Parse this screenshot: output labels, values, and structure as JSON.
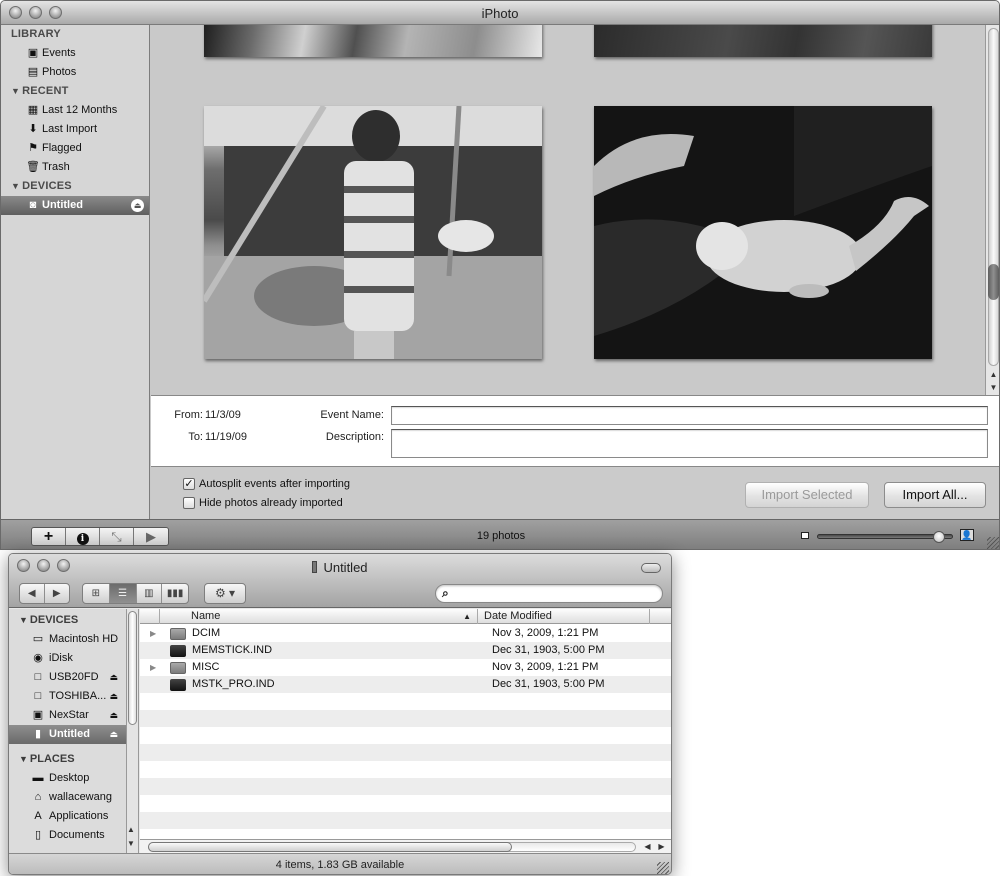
{
  "iphoto": {
    "title": "iPhoto",
    "sidebar": {
      "sections": [
        {
          "label": "LIBRARY",
          "collapsible": false,
          "items": [
            {
              "label": "Events",
              "icon": "events-icon"
            },
            {
              "label": "Photos",
              "icon": "photos-icon"
            }
          ]
        },
        {
          "label": "RECENT",
          "collapsible": true,
          "items": [
            {
              "label": "Last 12 Months",
              "icon": "calendar-icon"
            },
            {
              "label": "Last Import",
              "icon": "import-icon"
            },
            {
              "label": "Flagged",
              "icon": "flag-icon"
            },
            {
              "label": "Trash",
              "icon": "trash-icon"
            }
          ]
        },
        {
          "label": "DEVICES",
          "collapsible": true,
          "items": [
            {
              "label": "Untitled",
              "icon": "camera-icon",
              "selected": true,
              "eject": true
            }
          ]
        }
      ]
    },
    "photos": [
      {
        "description": "partial photo top-left"
      },
      {
        "description": "partial photo top-right"
      },
      {
        "description": "boy in striped shirt on swing set"
      },
      {
        "description": "cat on dark blanket"
      }
    ],
    "import_info": {
      "from_label": "From:",
      "from_value": "11/3/09",
      "to_label": "To:",
      "to_value": "11/19/09",
      "event_name_label": "Event Name:",
      "event_name_value": "",
      "description_label": "Description:",
      "description_value": ""
    },
    "options": {
      "autosplit_label": "Autosplit events after importing",
      "autosplit_checked": true,
      "hide_imported_label": "Hide photos already imported",
      "hide_imported_checked": false,
      "import_selected_label": "Import Selected",
      "import_all_label": "Import All..."
    },
    "toolbar": {
      "add_icon": "+",
      "info_icon": "i",
      "fullscreen_icon": "⤡",
      "play_icon": "▶",
      "photo_count": "19 photos",
      "zoom_level": 0.93
    },
    "scroll_position": 0.78
  },
  "finder": {
    "title": "Untitled",
    "search_placeholder": "",
    "view_modes": [
      "icon",
      "list",
      "column",
      "coverflow"
    ],
    "active_view": "list",
    "sidebar": {
      "devices_label": "DEVICES",
      "devices": [
        {
          "label": "Macintosh HD",
          "icon": "hard-drive-icon",
          "eject": false
        },
        {
          "label": "iDisk",
          "icon": "idisk-icon",
          "eject": false
        },
        {
          "label": "USB20FD",
          "icon": "drive-icon",
          "eject": true
        },
        {
          "label": "TOSHIBA...",
          "icon": "drive-icon",
          "eject": true
        },
        {
          "label": "NexStar",
          "icon": "drive-icon",
          "eject": true
        },
        {
          "label": "Untitled",
          "icon": "memory-card-icon",
          "eject": true,
          "selected": true
        }
      ],
      "places_label": "PLACES",
      "places": [
        {
          "label": "Desktop",
          "icon": "desktop-icon"
        },
        {
          "label": "wallacewang",
          "icon": "home-icon"
        },
        {
          "label": "Applications",
          "icon": "applications-icon"
        },
        {
          "label": "Documents",
          "icon": "documents-icon"
        }
      ]
    },
    "columns": {
      "name": "Name",
      "date_modified": "Date Modified"
    },
    "files": [
      {
        "name": "DCIM",
        "date": "Nov 3, 2009, 1:21 PM",
        "type": "folder"
      },
      {
        "name": "MEMSTICK.IND",
        "date": "Dec 31, 1903, 5:00 PM",
        "type": "file"
      },
      {
        "name": "MISC",
        "date": "Nov 3, 2009, 1:21 PM",
        "type": "folder"
      },
      {
        "name": "MSTK_PRO.IND",
        "date": "Dec 31, 1903, 5:00 PM",
        "type": "file"
      }
    ],
    "status": "4 items, 1.83 GB available"
  }
}
